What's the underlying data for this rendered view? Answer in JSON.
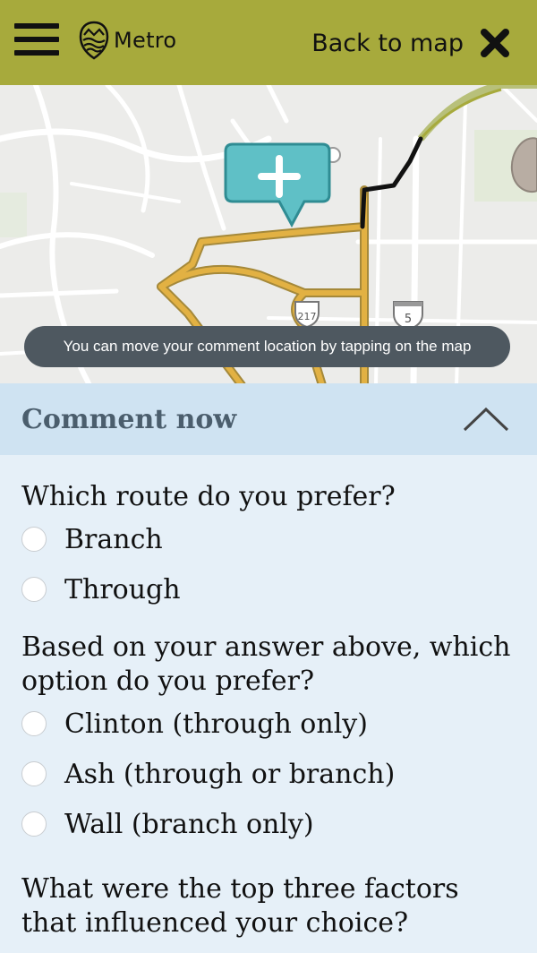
{
  "header": {
    "logo_text": "Metro",
    "back_label": "Back to map"
  },
  "map": {
    "toast": "You can move your comment location by tapping on the map",
    "shields": [
      "217",
      "5"
    ]
  },
  "panel": {
    "title": "Comment now",
    "questions": [
      {
        "text": "Which route do you prefer?",
        "options": [
          "Branch",
          "Through"
        ]
      },
      {
        "text": "Based on your answer above, which option do you prefer?",
        "options": [
          "Clinton (through only)",
          "Ash (through or branch)",
          "Wall (branch only)"
        ]
      },
      {
        "text": "What were the top three factors that influenced your choice?"
      }
    ]
  },
  "colors": {
    "header_bg": "#a7aa3c",
    "route": "#e2b143",
    "pin": "#5fc0c6",
    "panel_bg": "#e6f0f8",
    "panel_head_bg": "#cfe3f2"
  }
}
